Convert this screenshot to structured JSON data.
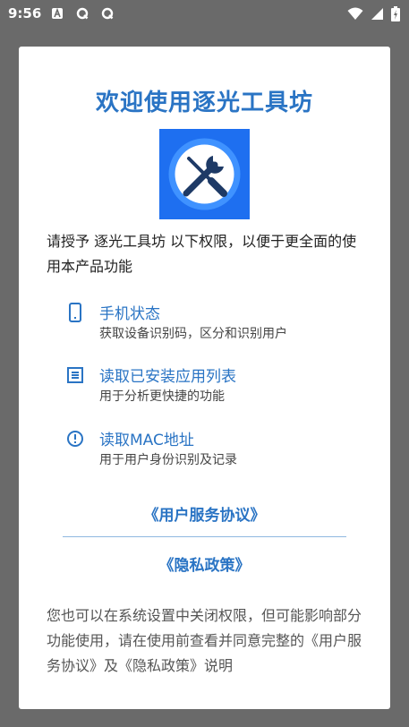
{
  "status_bar": {
    "time": "9:56",
    "left_icons": [
      "a-icon",
      "q-icon",
      "q-icon"
    ],
    "right_icons": [
      "wifi-icon",
      "signal-icon",
      "battery-charging-icon"
    ]
  },
  "dialog": {
    "title": "欢迎使用逐光工具坊",
    "logo_icon": "wrench-screwdriver-icon",
    "intro": "请授予 逐光工具坊 以下权限，以便于更全面的使用本产品功能",
    "permissions": [
      {
        "icon": "phone-icon",
        "title": "手机状态",
        "desc": "获取设备识别码，区分和识别用户"
      },
      {
        "icon": "list-icon",
        "title": "读取已安装应用列表",
        "desc": "用于分析更快捷的功能"
      },
      {
        "icon": "alert-icon",
        "title": "读取MAC地址",
        "desc": "用于用户身份识别及记录"
      }
    ],
    "links": {
      "user_agreement": "《用户服务协议》",
      "privacy_policy": "《隐私政策》"
    },
    "footer": "您也可以在系统设置中关闭权限，但可能影响部分功能使用，请在使用前查看并同意完整的《用户服务协议》及《隐私政策》说明"
  },
  "colors": {
    "accent": "#2a74c4",
    "logo_bg": "#1e6ff0",
    "overlay": "#6a6a6a"
  }
}
